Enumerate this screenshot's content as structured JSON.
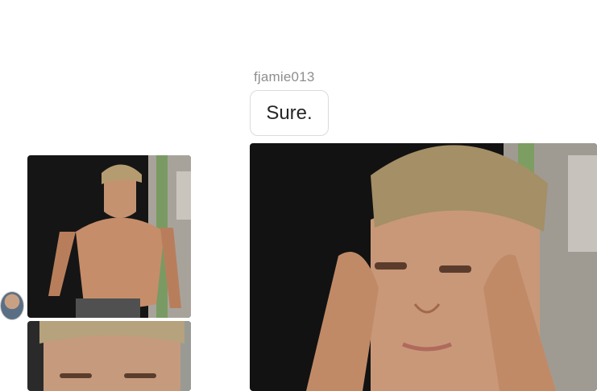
{
  "thread": {
    "sender_username": "fjamie013",
    "messages": [
      {
        "type": "text",
        "text": "Sure."
      }
    ]
  },
  "colors": {
    "username_text": "#8e8e8e",
    "bubble_border": "#dbdbdb",
    "bubble_text": "#262626",
    "background": "#ffffff"
  }
}
